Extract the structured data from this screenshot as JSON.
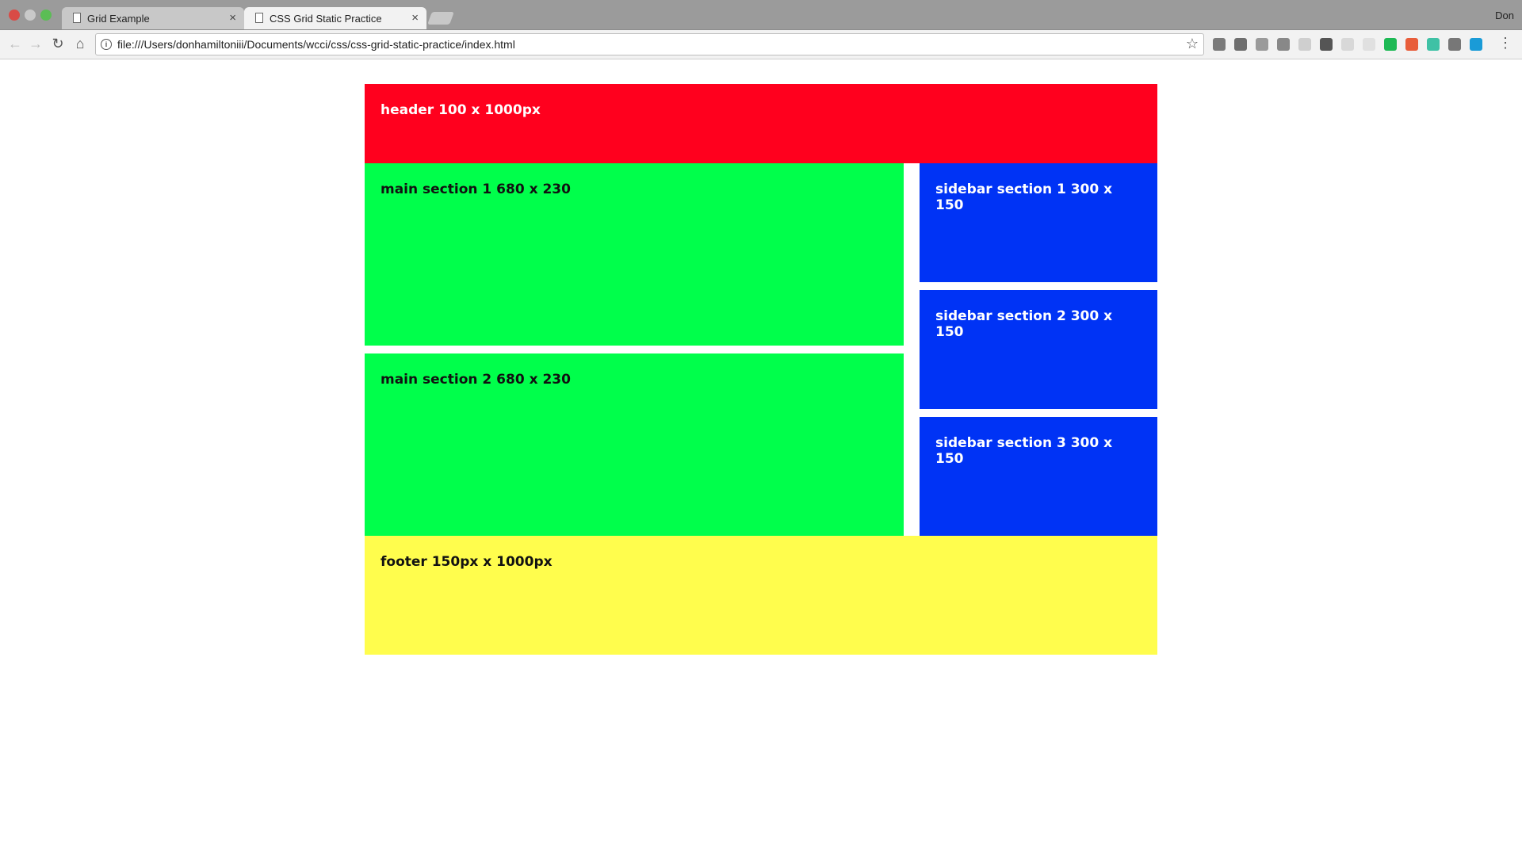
{
  "browser": {
    "tabs": [
      {
        "title": "Grid Example",
        "close": "×"
      },
      {
        "title": "CSS Grid Static Practice",
        "close": "×"
      }
    ],
    "profile": "Don",
    "nav": {
      "back": "←",
      "forward": "→",
      "reload": "↻",
      "home": "⌂"
    },
    "url": "file:///Users/donhamiltoniii/Documents/wcci/css/css-grid-static-practice/index.html",
    "info_icon": "i",
    "bookmark_star": "☆",
    "menu": "⋮",
    "extension_colors": [
      "#7a7a7a",
      "#6e6e6e",
      "#9a9a9a",
      "#888888",
      "#cfcfcf",
      "#555555",
      "#d8d8d8",
      "#e0e0e0",
      "#1db954",
      "#e85d3a",
      "#3fc1a5",
      "#777777",
      "#1a9bd7"
    ]
  },
  "page": {
    "header": "header 100 x 1000px",
    "main1": "main section 1 680 x 230",
    "main2": "main section 2 680 x 230",
    "side1": "sidebar section 1 300 x 150",
    "side2": "sidebar section 2 300 x 150",
    "side3": "sidebar section 3 300 x 150",
    "footer": "footer 150px x 1000px"
  },
  "colors": {
    "header": "#ff001e",
    "main": "#00ff4b",
    "sidebar": "#0033f5",
    "footer": "#fffd4d"
  }
}
